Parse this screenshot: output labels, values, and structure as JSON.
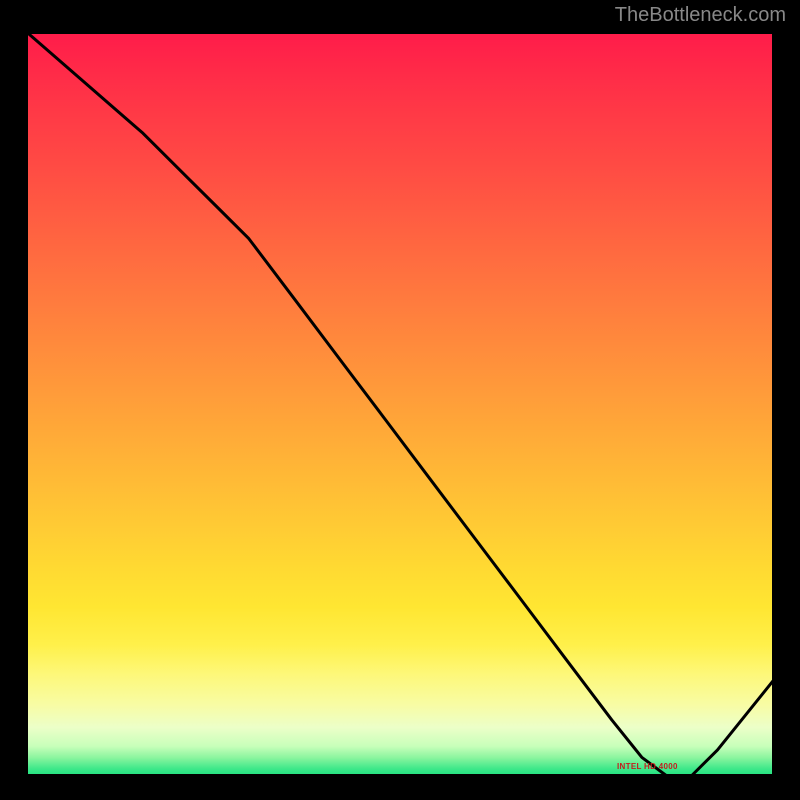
{
  "watermark": "TheBottleneck.com",
  "tiny_label": "INTEL HD 4000",
  "chart_data": {
    "type": "line",
    "title": "",
    "xlabel": "",
    "ylabel": "",
    "x_range": [
      0,
      100
    ],
    "y_range": [
      0,
      100
    ],
    "series": [
      {
        "name": "curve",
        "x": [
          0,
          8,
          16,
          22,
          26,
          30,
          36,
          42,
          48,
          54,
          60,
          66,
          72,
          78,
          82,
          86,
          88,
          92,
          100
        ],
        "y": [
          100,
          93,
          86,
          80,
          76,
          72,
          64,
          56,
          48,
          40,
          32,
          24,
          16,
          8,
          3,
          0,
          0,
          4,
          14
        ]
      }
    ],
    "gradient_stops": [
      {
        "pos": 0.0,
        "hex": "#ff1a4a"
      },
      {
        "pos": 0.25,
        "hex": "#ff5a42"
      },
      {
        "pos": 0.5,
        "hex": "#ff9a3a"
      },
      {
        "pos": 0.75,
        "hex": "#ffe632"
      },
      {
        "pos": 0.9,
        "hex": "#f8fca4"
      },
      {
        "pos": 1.0,
        "hex": "#0ee07a"
      }
    ],
    "annotation": {
      "text_key": "tiny_label",
      "x": 84,
      "y": 1
    }
  }
}
